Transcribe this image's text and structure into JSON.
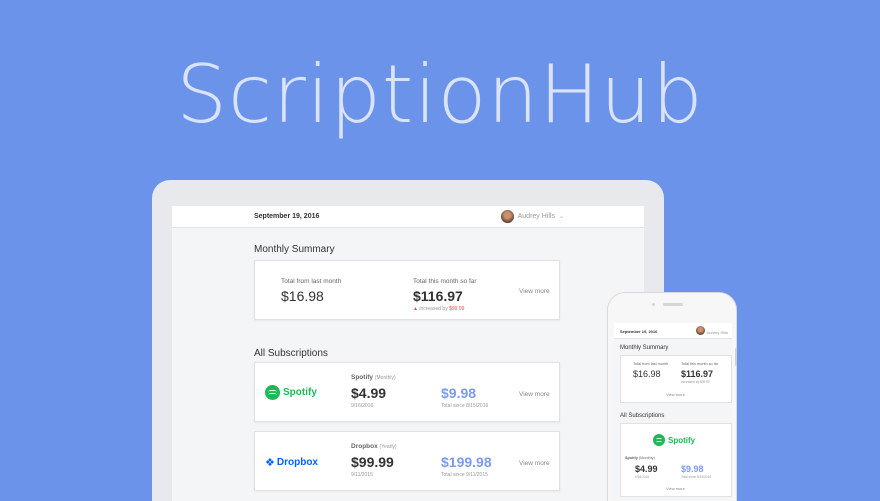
{
  "brand": {
    "title": "ScriptionHub"
  },
  "header": {
    "date": "September 19, 2016",
    "user_name": "Audrey Hills"
  },
  "monthly_summary": {
    "title": "Monthly Summary",
    "last_month_label": "Total from last month",
    "last_month_value": "$16.98",
    "this_month_label": "Total this month so far",
    "this_month_value": "$116.97",
    "increase_prefix": "increased by",
    "increase_value": "$99.99",
    "view_more": "View more"
  },
  "subscriptions": {
    "title": "All Subscriptions",
    "items": [
      {
        "brand": "Spotify",
        "name": "Spotify",
        "period": "(Monthly)",
        "price": "$4.99",
        "date": "9/16/2016",
        "total": "$9.98",
        "total_label": "Total since 8/15/2016",
        "view_more": "View more"
      },
      {
        "brand": "Dropbox",
        "name": "Dropbox",
        "period": "(Yearly)",
        "price": "$99.99",
        "date": "9/11/2015",
        "total": "$199.98",
        "total_label": "Total since 9/11/2015",
        "view_more": "View more"
      }
    ]
  },
  "mobile": {
    "date": "September 19, 2016",
    "user_name": "Audrey Hills",
    "summary_title": "Monthly Summary",
    "last_month_label": "Total from last month",
    "last_month_value": "$16.98",
    "this_month_label": "Total this month so far",
    "this_month_value": "$116.97",
    "increase_text": "increased by $99.99",
    "view_more": "View more",
    "subs_title": "All Subscriptions",
    "sub_brand": "Spotify",
    "sub_name": "Spotify",
    "sub_period": "(Monthly)",
    "sub_price": "$4.99",
    "sub_date": "9/16/2016",
    "sub_total": "$9.98",
    "sub_total_label": "Total since 8/15/2016",
    "sub_view_more": "View more"
  },
  "colors": {
    "background": "#6b93ea",
    "accent": "#7c9bea",
    "spotify": "#1db954",
    "dropbox": "#0061fe",
    "increase": "#e25555"
  }
}
